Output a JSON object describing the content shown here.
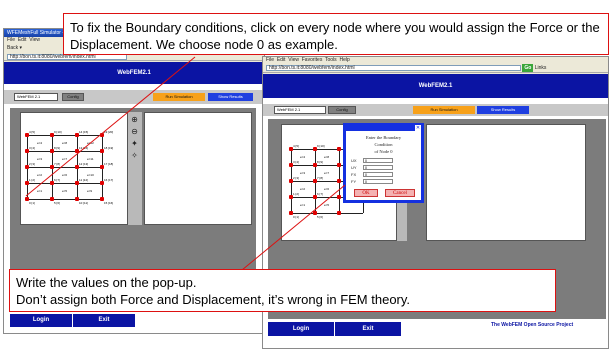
{
  "callouts": {
    "top": "To fix the Boundary conditions, click on every node where you would assign the Force or the Displacement. We choose node 0 as example.",
    "bottom_line1": "Write the values on the pop-up.",
    "bottom_line2": "Don’t assign both Force and Displacement, it’s wrong in FEM theory."
  },
  "left_window": {
    "title": "WFEMeshFull Simulator - Mi...",
    "toolbar": "Back ▾",
    "address": "http://bon.ts.it:8080/webfem/index.html",
    "banner": "WebFEM2.1",
    "field_value": "WebFEM 2.1",
    "config_button": "Config",
    "run_button": "Run Simulation",
    "results_button": "Show Results",
    "login_button": "Login",
    "exit_button": "Exit"
  },
  "right_window": {
    "address": "http://bon.ts.it:8080/webfem/index.html",
    "go_label": "Go",
    "links_label": "Links",
    "banner": "WebFEM2.1",
    "field_value": "WebFEM 2.1",
    "config_button": "Config",
    "run_button": "Run Simulation",
    "results_button": "Show Results",
    "login_button": "Login",
    "exit_button": "Exit",
    "footer_text": "The WebFEM Open Source Project"
  },
  "popup": {
    "line1": "Enter the Boundary",
    "line2": "Condition",
    "line3": "of Node 0",
    "labels": [
      "UX",
      "UY",
      "FX",
      "FY"
    ],
    "values": [
      "0",
      "0",
      "0",
      "0"
    ],
    "ok": "OK",
    "cancel": "Cancel"
  },
  "mesh": {
    "node_labels": [
      "4 [5]",
      "9 [10]",
      "14 [15]",
      "19 [20]",
      "3 [4]",
      "8 [9]",
      "13 [14]",
      "18 [19]",
      "2 [3]",
      "7 [8]",
      "12 [13]",
      "17 [18]",
      "1 [2]",
      "6 [7]",
      "11 [12]",
      "16 [17]",
      "0 [1]",
      "5 [6]",
      "10 [11]",
      "15 [16]"
    ],
    "elem_labels": [
      "e=4",
      "e=8",
      "e=12",
      "e=3",
      "e=7",
      "e=11",
      "e=2",
      "e=6",
      "e=10",
      "e=1",
      "e=5",
      "e=9"
    ]
  },
  "colors": {
    "banner": "#0b14a3",
    "run": "#f7a11a",
    "results": "#1f3fe0",
    "callout_border": "#d11111",
    "node": "#e00000"
  },
  "icons": [
    "zoom-in-icon",
    "zoom-out-icon",
    "pan-icon",
    "rotate-icon"
  ]
}
